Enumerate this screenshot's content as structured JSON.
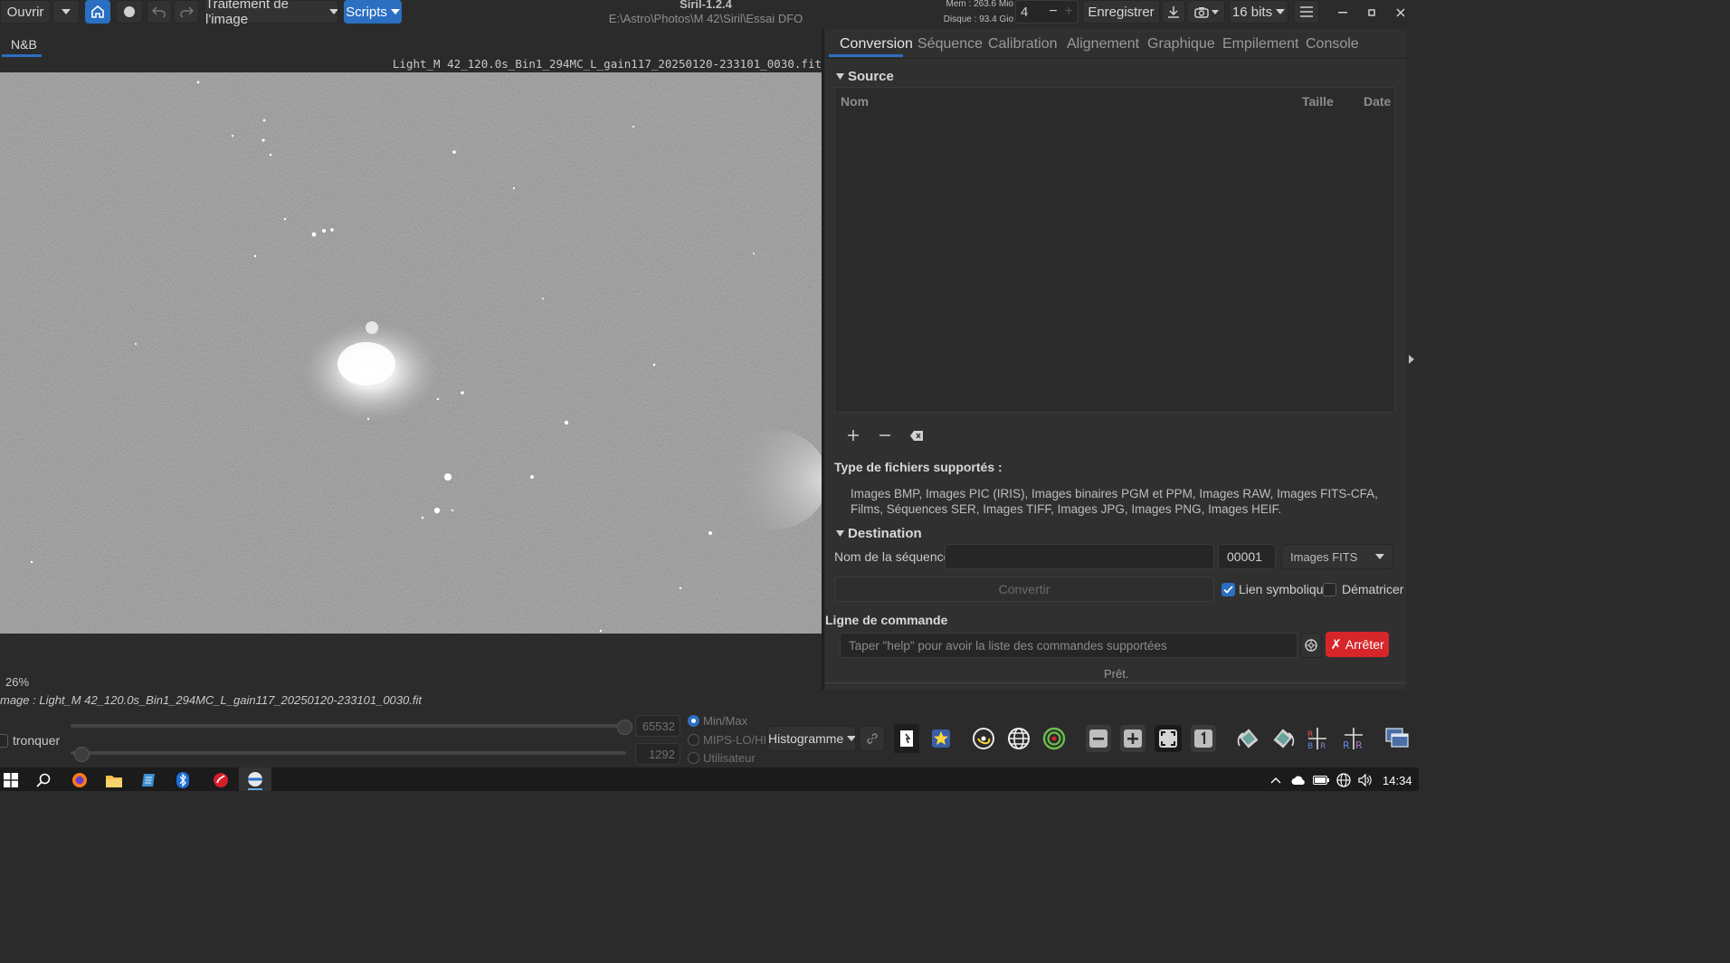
{
  "colors": {
    "accent": "#2a6fc2",
    "danger": "#d7262a",
    "window_bg": "#2b2b2b",
    "panel_bg": "#303030",
    "taskbar": "#1b1b1b"
  },
  "header": {
    "open_label": "Ouvrir",
    "image_processing_label": "Traitement de l'image",
    "scripts_label": "Scripts",
    "app_title": "Siril-1.2.4",
    "working_dir": "E:\\Astro\\Photos\\M 42\\Siril\\Essai DFO",
    "mem_label": "Mem : 263.6 Mio",
    "disk_label": "Disque : 93.4 Gio",
    "threads_value": "4",
    "save_label": "Enregistrer",
    "bitdepth_label": "16 bits"
  },
  "viewer": {
    "channel_tab": "N&B",
    "filename": "Light_M 42_120.0s_Bin1_294MC_L_gain117_20250120-233101_0030.fit",
    "zoom_label": "26%",
    "image_info": "mage : Light_M 42_120.0s_Bin1_294MC_L_gain117_20250120-233101_0030.fit"
  },
  "right_panel": {
    "tabs": [
      "Conversion",
      "Séquence",
      "Calibration",
      "Alignement",
      "Graphique",
      "Empilement",
      "Console"
    ],
    "active_tab": 0,
    "source_label": "Source",
    "table_headers": {
      "name": "Nom",
      "size": "Taille",
      "date": "Date"
    },
    "supported_label": "Type de fichiers supportés :",
    "supported_text": "Images BMP, Images PIC (IRIS), Images binaires PGM et PPM, Images RAW, Images FITS-CFA, Films, Séquences SER, Images TIFF, Images JPG, Images PNG, Images HEIF.",
    "destination_label": "Destination",
    "seq_name_label": "Nom de la séquence :",
    "seq_name_value": "",
    "seq_start_value": "00001",
    "format_value": "Images FITS",
    "convert_label": "Convertir",
    "symlink_label": "Lien symbolique",
    "symlink_checked": true,
    "debayer_label": "Dématricer",
    "debayer_checked": false
  },
  "command": {
    "label": "Ligne de commande",
    "placeholder": "Taper \"help\" pour avoir la liste des commandes supportées",
    "stop_label": "Arrêter",
    "status": "Prêt."
  },
  "bottom": {
    "clip_label": "tronquer",
    "high_value": "65532",
    "low_value": "1292",
    "mode_options": [
      "Min/Max",
      "MIPS-LO/HI",
      "Utilisateur"
    ],
    "mode_selected": 0,
    "display_mode": "Histogramme"
  },
  "taskbar": {
    "time": "14:34"
  }
}
